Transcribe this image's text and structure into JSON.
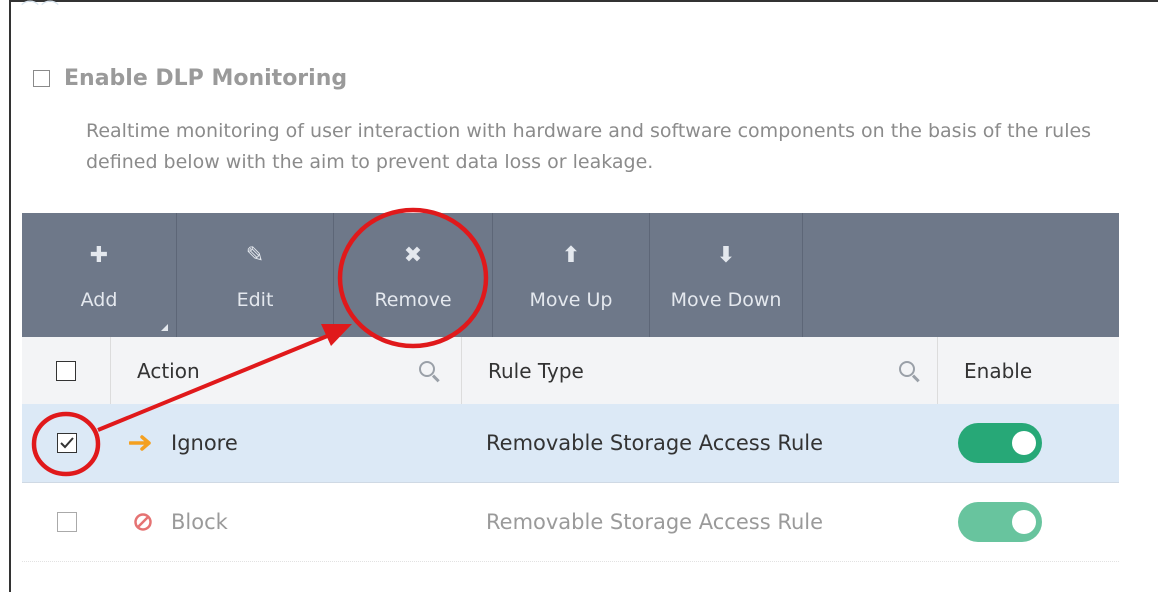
{
  "enable_dlp": {
    "label": "Enable DLP Monitoring",
    "checked": false
  },
  "description": "Realtime monitoring of user interaction with hardware and software components on the basis of the rules defined below with the aim to prevent data loss or leakage.",
  "toolbar": {
    "add": {
      "label": "Add",
      "icon": "plus-icon"
    },
    "edit": {
      "label": "Edit",
      "icon": "pencil-icon"
    },
    "remove": {
      "label": "Remove",
      "icon": "x-icon"
    },
    "move_up": {
      "label": "Move Up",
      "icon": "arrow-up-icon"
    },
    "move_down": {
      "label": "Move Down",
      "icon": "arrow-down-icon"
    }
  },
  "table": {
    "columns": {
      "action": "Action",
      "rule_type": "Rule Type",
      "enable": "Enable"
    },
    "rows": [
      {
        "selected": true,
        "action": "Ignore",
        "action_icon": "arrow-right-icon",
        "rule_type": "Removable Storage Access Rule",
        "enabled": true
      },
      {
        "selected": false,
        "action": "Block",
        "action_icon": "no-entry-icon",
        "rule_type": "Removable Storage Access Rule",
        "enabled": true
      }
    ]
  },
  "colors": {
    "toolbar_bg": "#6e7889",
    "selected_row": "#dce9f6",
    "toggle_on": "#27a877",
    "toggle_on_faded": "#68c49e",
    "annotation_red": "#e0191b",
    "ignore_arrow": "#f4a020",
    "block_icon": "#e57373"
  }
}
